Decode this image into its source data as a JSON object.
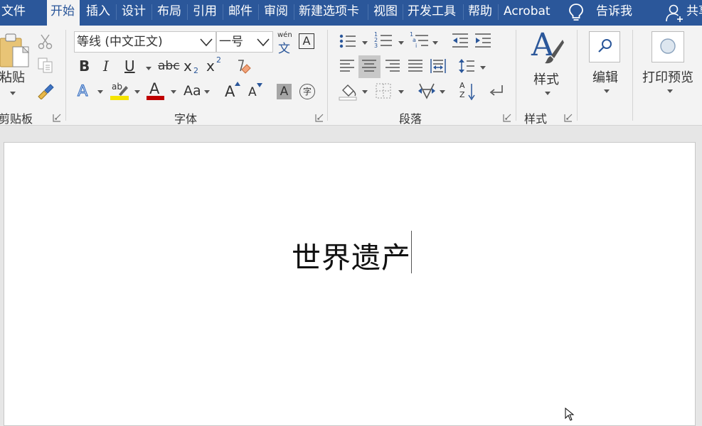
{
  "tabs": [
    {
      "label": "文件"
    },
    {
      "label": "开始"
    },
    {
      "label": "插入"
    },
    {
      "label": "设计"
    },
    {
      "label": "布局"
    },
    {
      "label": "引用"
    },
    {
      "label": "邮件"
    },
    {
      "label": "审阅"
    },
    {
      "label": "新建选项卡"
    },
    {
      "label": "视图"
    },
    {
      "label": "开发工具"
    },
    {
      "label": "帮助"
    },
    {
      "label": "Acrobat"
    }
  ],
  "active_tab": "开始",
  "tell_me": "告诉我",
  "share": "共享",
  "clipboard": {
    "paste_label": "粘贴",
    "group_label": "剪贴板"
  },
  "font": {
    "font_name": "等线 (中文正文)",
    "font_size": "一号",
    "phonetic_top": "wén",
    "phonetic_char": "文",
    "border_char": "A",
    "bold": "B",
    "italic": "I",
    "underline": "U",
    "strike": "abc",
    "sub_base": "x",
    "sub_mark": "2",
    "sup_base": "x",
    "sup_mark": "2",
    "text_effect": "A",
    "highlight_ab": "ab",
    "font_color_a": "A",
    "change_case": "Aa",
    "grow": "A",
    "shrink": "A",
    "shading_a": "A",
    "enclose": "字",
    "group_label": "字体",
    "highlight_color": "#f5e400",
    "font_color": "#c00000"
  },
  "paragraph": {
    "group_label": "段落",
    "list_digits": [
      "1",
      "2",
      "3"
    ],
    "multilevel": [
      "1",
      "a",
      "i"
    ],
    "sort_a": "A",
    "sort_z": "Z"
  },
  "styles": {
    "label": "样式",
    "group_label": "样式",
    "icon_letter": "A"
  },
  "editing": {
    "label": "编辑"
  },
  "print_preview": {
    "label": "打印预览"
  },
  "document": {
    "text": "世界遗产"
  },
  "colors": {
    "title_bar": "#2b579a",
    "ribbon": "#f3f3f3",
    "accent": "#2b579a"
  }
}
